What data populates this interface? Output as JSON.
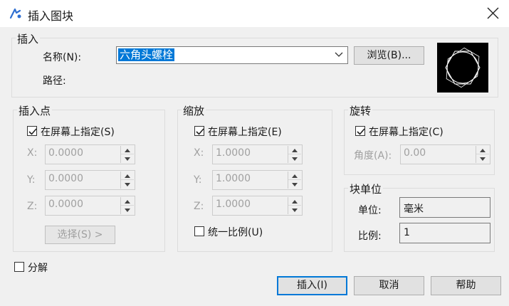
{
  "window": {
    "title": "插入图块",
    "icon": "cad-app-icon"
  },
  "insert_section": {
    "legend": "插入",
    "name_label": "名称(N):",
    "name_value": "六角头螺栓",
    "browse_button": "浏览(B)...",
    "path_label": "路径:",
    "preview_icon": "hex-bolt-preview"
  },
  "insertion_point": {
    "legend": "插入点",
    "specify_on_screen": "在屏幕上指定(S)",
    "checked": true,
    "x_label": "X:",
    "x_value": "0.0000",
    "y_label": "Y:",
    "y_value": "0.0000",
    "z_label": "Z:",
    "z_value": "0.0000",
    "select_button": "选择(S) >"
  },
  "scale": {
    "legend": "缩放",
    "specify_on_screen": "在屏幕上指定(E)",
    "checked": true,
    "x_label": "X:",
    "x_value": "1.0000",
    "y_label": "Y:",
    "y_value": "1.0000",
    "z_label": "Z:",
    "z_value": "1.0000",
    "uniform_scale": "统一比例(U)",
    "uniform_checked": false
  },
  "rotation": {
    "legend": "旋转",
    "specify_on_screen": "在屏幕上指定(C)",
    "checked": true,
    "angle_label": "角度(A):",
    "angle_value": "0.00"
  },
  "block_unit": {
    "legend": "块单位",
    "unit_label": "单位:",
    "unit_value": "毫米",
    "factor_label": "比例:",
    "factor_value": "1"
  },
  "explode": {
    "label": "分解",
    "checked": false
  },
  "buttons": {
    "insert": "插入(I)",
    "cancel": "取消",
    "help": "帮助"
  }
}
